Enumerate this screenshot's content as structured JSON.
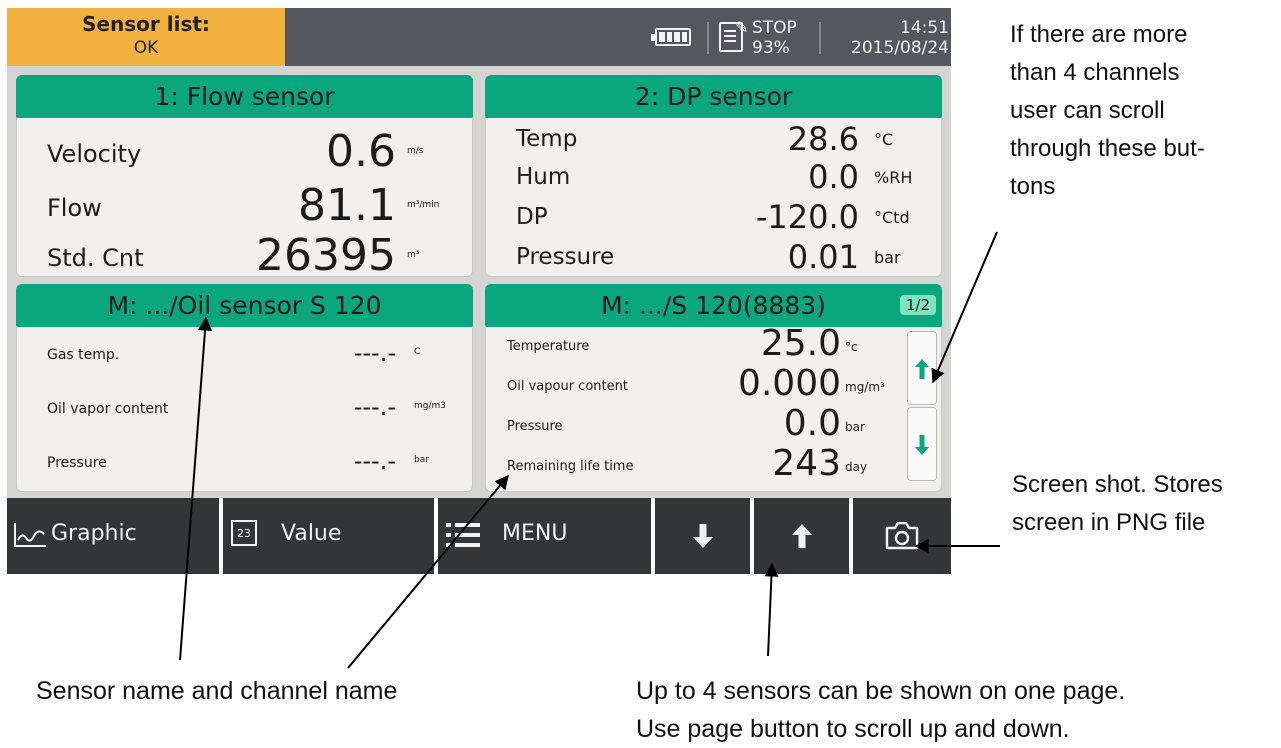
{
  "status_bar": {
    "sensor_list_label": "Sensor list:",
    "sensor_list_value": "OK",
    "rec_icon_label": "✎",
    "rec_state": "STOP",
    "rec_percent": "93%",
    "time": "14:51",
    "date": "2015/08/24"
  },
  "panels": [
    {
      "title": "1: Flow sensor",
      "rows": [
        {
          "label": "Velocity",
          "value": "0.6",
          "unit": "m/s"
        },
        {
          "label": "Flow",
          "value": "81.1",
          "unit": "m³/min"
        },
        {
          "label": "Std. Cnt",
          "value": "26395",
          "unit": "m³"
        }
      ]
    },
    {
      "title": "2: DP sensor",
      "rows": [
        {
          "label": "Temp",
          "value": "28.6",
          "unit": "°C"
        },
        {
          "label": "Hum",
          "value": "0.0",
          "unit": "%RH"
        },
        {
          "label": "DP",
          "value": "-120.0",
          "unit": "°Ctd"
        },
        {
          "label": "Pressure",
          "value": "0.01",
          "unit": "bar"
        }
      ]
    },
    {
      "title": "M: .../Oil sensor S 120",
      "rows": [
        {
          "label": "Gas temp.",
          "value": "---.-",
          "unit": "C"
        },
        {
          "label": "Oil vapor content",
          "value": "---.-",
          "unit": "mg/m3"
        },
        {
          "label": "Pressure",
          "value": "---.-",
          "unit": "bar"
        }
      ]
    },
    {
      "title": "M: .../S 120(8883)",
      "page": "1/2",
      "rows": [
        {
          "label": "Temperature",
          "value": "25.0",
          "unit": "°c"
        },
        {
          "label": "Oil vapour content",
          "value": "0.000",
          "unit": "mg/m³"
        },
        {
          "label": "Pressure",
          "value": "0.0",
          "unit": "bar"
        },
        {
          "label": "Remaining life time",
          "value": "243",
          "unit": "day"
        }
      ]
    }
  ],
  "toolbar": {
    "graphic_label": "Graphic",
    "value_icon_text": "23",
    "value_label": "Value",
    "menu_label": "MENU"
  },
  "annotations": {
    "scroll_note": [
      "If there are more",
      "than 4 channels",
      "user can scroll",
      "through these but-",
      "tons"
    ],
    "screenshot_note": [
      "Screen shot. Stores",
      "screen in PNG file"
    ],
    "sensor_name_note": "Sensor name and channel name",
    "page_note": [
      "Up to 4 sensors can be shown on one page.",
      "Use page button to scroll up and down."
    ]
  },
  "colors": {
    "status_ok": "#f3b13f",
    "panel_header": "#0aa77f",
    "toolbar": "#333537",
    "scroll_arrow": "#0aa77f"
  }
}
